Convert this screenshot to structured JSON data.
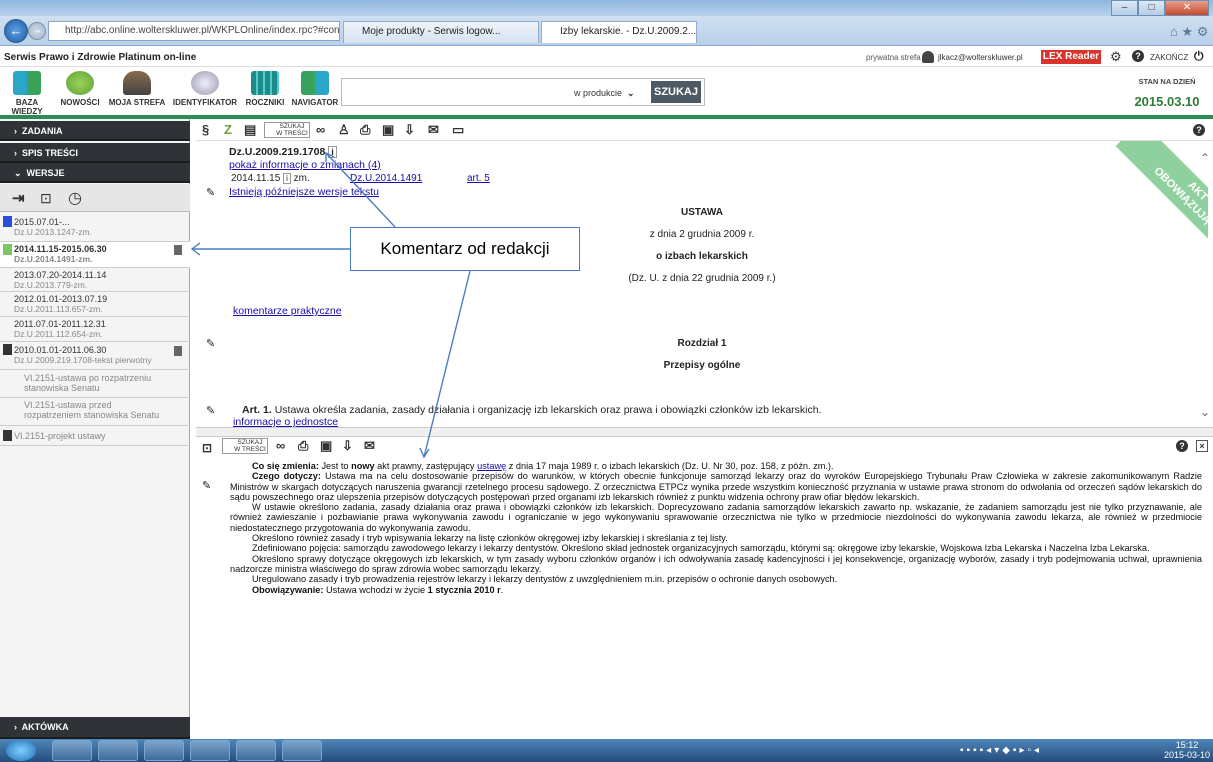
{
  "browser": {
    "address": "http://abc.online.wolterskluwer.pl/WKPLOnline/index.rpc?#content.rpc--",
    "address_host": "abc.online.wolterskluwer.pl",
    "tabs": [
      "Moje produkty - Serwis logow...",
      "Izby lekarskie. - Dz.U.2009.2..."
    ]
  },
  "site": {
    "title": "Serwis Prawo i Zdrowie Platinum on-line",
    "private_zone": "prywatna strefa",
    "user": "jlkacz@wolterskluwer.pl",
    "lex_reader": "LEX Reader",
    "logout": "ZAKOŃCZ"
  },
  "toolbar": {
    "items": [
      "BAZA WIEDZY",
      "NOWOŚCI",
      "MOJA STREFA",
      "IDENTYFIKATOR",
      "ROCZNIKI",
      "NAVIGATOR"
    ],
    "search_scope": "w produkcie",
    "search_button": "SZUKAJ",
    "date_label": "STAN NA DZIEŃ",
    "date_value": "2015.03.10"
  },
  "left": {
    "zadania": "ZADANIA",
    "spis": "SPIS TREŚCI",
    "wersje": "WERSJE",
    "aktowka": "AKTÓWKA",
    "versions": [
      {
        "date": "2015.07.01-...",
        "ref": "Dz.U.2013.1247-zm."
      },
      {
        "date": "2014.11.15-2015.06.30",
        "ref": "Dz.U.2014.1491-zm."
      },
      {
        "date": "2013.07.20-2014.11.14",
        "ref": "Dz.U.2013.779-zm."
      },
      {
        "date": "2012.01.01-2013.07.19",
        "ref": "Dz.U.2011.113.657-zm."
      },
      {
        "date": "2011.07.01-2011.12.31",
        "ref": "Dz.U.2011.112.654-zm."
      },
      {
        "date": "2010.01.01-2011.06.30",
        "ref": "Dz.U.2009.219.1708-tekst pierwotny"
      },
      {
        "date": "VI.2151-ustawa po rozpatrzeniu",
        "ref": "stanowiska Senatu"
      },
      {
        "date": "VI.2151-ustawa przed",
        "ref": "rozpatrzeniem stanowiska Senatu"
      },
      {
        "date": "VI.2151-projekt ustawy",
        "ref": ""
      }
    ]
  },
  "doc": {
    "search_btn_line1": "SZUKAJ",
    "search_btn_line2": "W TREŚCI",
    "ref": "Dz.U.2009.219.1708",
    "info_mark": "i",
    "changes_link": "pokaż informacje o zmianach (4)",
    "change_date": "2014.11.15",
    "change_zm": "zm.",
    "change_act": "Dz.U.2014.1491",
    "change_art": "art. 5",
    "later_versions": "Istnieją późniejsze wersje tekstu",
    "type": "USTAWA",
    "date": "z dnia 2 grudnia 2009 r.",
    "subject": "o izbach lekarskich",
    "publication": "(Dz. U. z dnia 22 grudnia 2009 r.)",
    "commentary_link": "komentarze praktyczne",
    "chapter": "Rozdział 1",
    "chapter_title": "Przepisy ogólne",
    "art_label": "Art. 1.",
    "art_text": "Ustawa określa zadania, zasady działania i organizację izb lekarskich oraz prawa i obowiązki członków izb lekarskich.",
    "unit_info": "informacje o jednostce",
    "ribbon_line1": "AKT",
    "ribbon_line2": "OBOWIĄZUJĄCY"
  },
  "callout": "Komentarz od redakcji",
  "comment": {
    "p1_label": "Co się zmienia:",
    "p1_a": "Jest to",
    "p1_bold": "nowy",
    "p1_b": "akt prawny, zastępujący",
    "p1_link": "ustawę",
    "p1_c": "z dnia 17 maja 1989 r. o izbach lekarskich (Dz. U. Nr 30, poz. 158, z późn. zm.).",
    "p2_label": "Czego dotyczy:",
    "p2": "Ustawa ma na celu dostosowanie przepisów do warunków, w których obecnie funkcjonuje samorząd lekarzy oraz do wyroków Europejskiego Trybunału Praw Człowieka w zakresie zakomunikowanym Radzie Ministrów w skargach dotyczących naruszenia gwarancji rzetelnego procesu sądowego. Z orzecznictwa ETPCz wynika przede wszystkim konieczność przyznania w ustawie prawa stronom do odwołania od orzeczeń sądów lekarskich do sądu powszechnego oraz ulepszenia przepisów dotyczących postępowań przed organami izb lekarskich również z punktu widzenia ochrony praw ofiar błędów lekarskich.",
    "p3": "W ustawie określono zadania, zasady działania oraz prawa i obowiązki członków izb lekarskich. Doprecyzowano zadania samorządów lekarskich zawarto np. wskazanie, że zadaniem samorządu jest nie tylko przyznawanie, ale również zawieszanie i pozbawianie prawa wykonywania zawodu i ograniczanie w jego wykonywaniu sprawowanie orzecznictwa nie tylko w przedmiocie niezdolności do wykonywania zawodu lekarza, ale również w przedmiocie niedostatecznego przygotowania do wykonywania zawodu.",
    "p4": "Określono również zasady i tryb wpisywania lekarzy na listę członków okręgowej izby lekarskiej i skreślania z tej listy.",
    "p5": "Zdefiniowano pojęcia: samorządu zawodowego lekarzy i lekarzy dentystów. Określono skład jednostek organizacyjnych samorządu, którymi są: okręgowe izby lekarskie, Wojskowa Izba Lekarska i Naczelna Izba Lekarska.",
    "p6": "Określono sprawy dotyczące okręgowych izb lekarskich, w tym zasady wyboru członków organów i ich odwoływania zasadę kadencyjności i jej konsekwencje, organizację wyborów, zasady i tryb podejmowania uchwał, uprawnienia nadzorcze ministra właściwego do spraw zdrowia wobec samorządu lekarzy.",
    "p7": "Uregulowano zasady i tryb prowadzenia rejestrów lekarzy i lekarzy dentystów z uwzględnieniem m.in. przepisów o ochronie danych osobowych.",
    "p8_label": "Obowiązywanie:",
    "p8_a": "Ustawa wchodzi w życie",
    "p8_bold": "1 stycznia 2010 r",
    "p8_b": "."
  },
  "taskbar": {
    "time": "15:12",
    "date": "2015-03-10"
  },
  "colors": {
    "accent": "#2e8b57",
    "dark": "#2f3338",
    "link": "#1a0dab",
    "lex": "#d9342b"
  }
}
